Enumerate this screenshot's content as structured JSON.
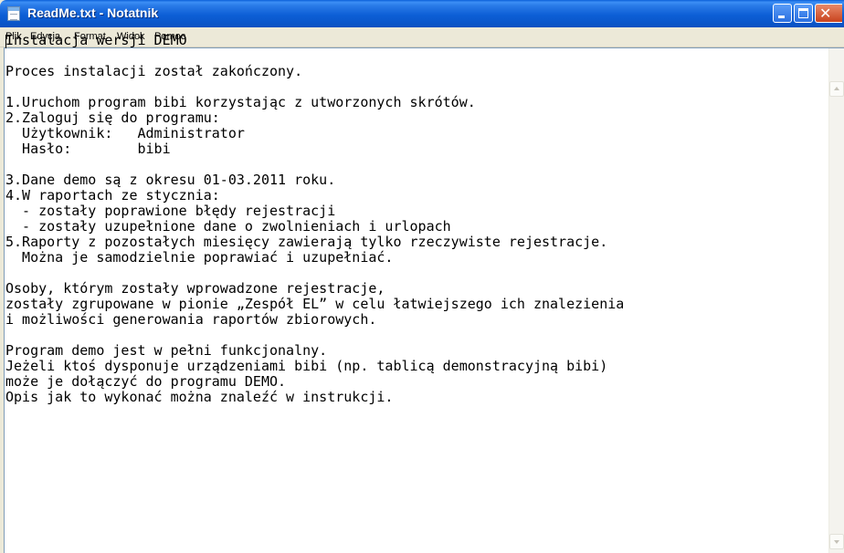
{
  "window": {
    "title": "ReadMe.txt - Notatnik",
    "icon": "notepad-icon",
    "controls": {
      "minimize": "minimize-icon",
      "maximize": "maximize-icon",
      "close": "close-icon",
      "close_glyph": "✕"
    }
  },
  "menu": {
    "items": [
      {
        "label": "Plik"
      },
      {
        "label": "Edycja"
      },
      {
        "label": "Format"
      },
      {
        "label": "Widok"
      },
      {
        "label": "Pomoc"
      }
    ]
  },
  "document": {
    "text": "Instalacja wersji DEMO\n\nProces instalacji został zakończony.\n\n1.Uruchom program bibi korzystając z utworzonych skrótów.\n2.Zaloguj się do programu:\n  Użytkownik:   Administrator\n  Hasło:        bibi\n\n3.Dane demo są z okresu 01-03.2011 roku.\n4.W raportach ze stycznia:\n  - zostały poprawione błędy rejestracji\n  - zostały uzupełnione dane o zwolnieniach i urlopach\n5.Raporty z pozostałych miesięcy zawierają tylko rzeczywiste rejestracje.\n  Można je samodzielnie poprawiać i uzupełniać.\n\nOsoby, którym zostały wprowadzone rejestracje,\nzostały zgrupowane w pionie „Zespół EL” w celu łatwiejszego ich znalezienia\ni możliwości generowania raportów zbiorowych.\n\nProgram demo jest w pełni funkcjonalny.\nJeżeli ktoś dysponuje urządzeniami bibi (np. tablicą demonstracyjną bibi)\nmoże je dołączyć do programu DEMO.\nOpis jak to wykonać można znaleźć w instrukcji."
  },
  "colors": {
    "titlebar": "#0a5fd9",
    "close_button": "#c8431e",
    "menubar": "#ece9d8",
    "editor_bg": "#ffffff"
  }
}
